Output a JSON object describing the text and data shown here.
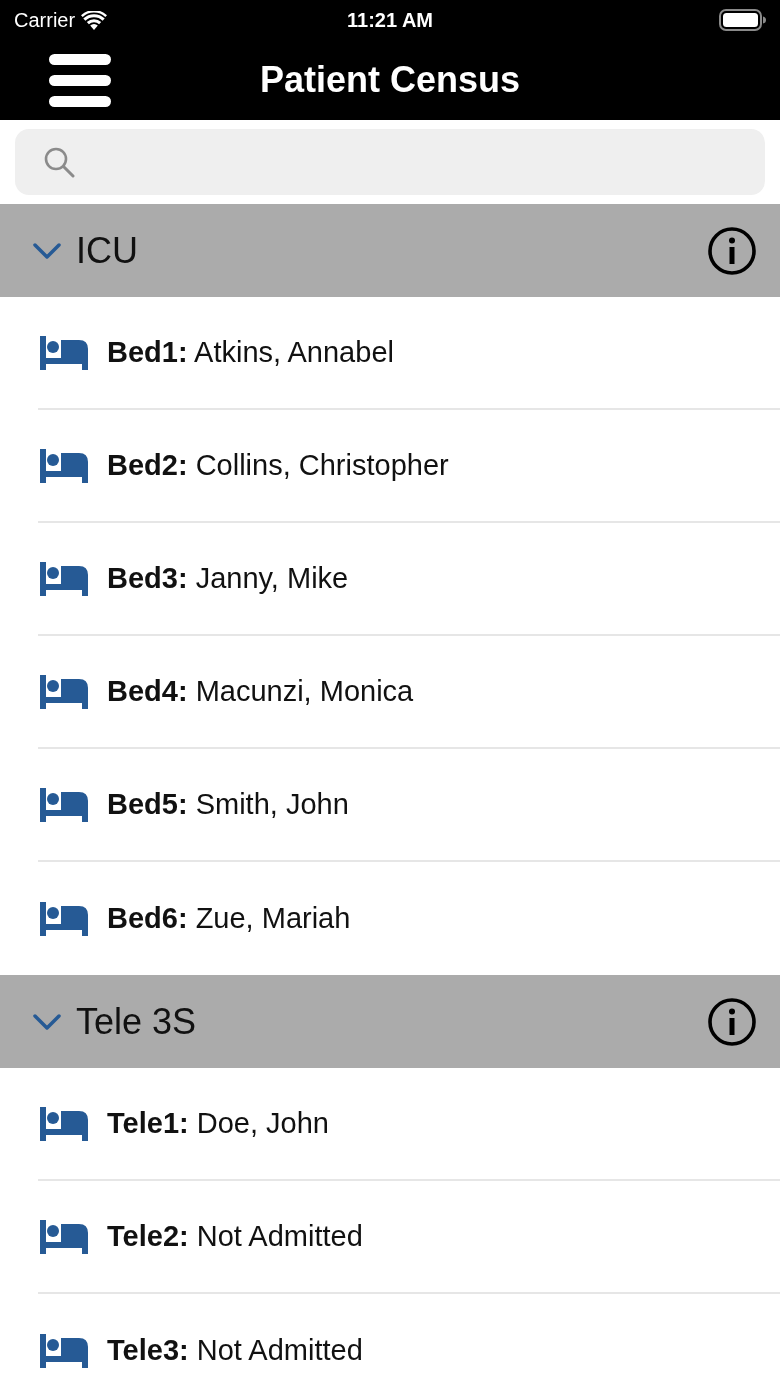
{
  "status_bar": {
    "carrier": "Carrier",
    "time": "11:21 AM"
  },
  "nav_bar": {
    "title": "Patient Census"
  },
  "sections": [
    {
      "title": "ICU",
      "expanded": true,
      "rows": [
        {
          "label": "**Bed1:** Atkins, Annabel"
        },
        {
          "label": "**Bed2:** Collins, Christopher"
        },
        {
          "label": "**Bed3:** Janny, Mike"
        },
        {
          "label": "**Bed4:** Macunzi, Monica"
        },
        {
          "label": "**Bed5:** Smith, John"
        },
        {
          "label": "**Bed6:** Zue, Mariah"
        }
      ]
    },
    {
      "title": "Tele 3S",
      "expanded": true,
      "rows": [
        {
          "label": "**Tele1:** Doe, John"
        },
        {
          "label": "**Tele2:** Not Admitted"
        },
        {
          "label": "**Tele3:** Not Admitted"
        }
      ]
    }
  ]
}
